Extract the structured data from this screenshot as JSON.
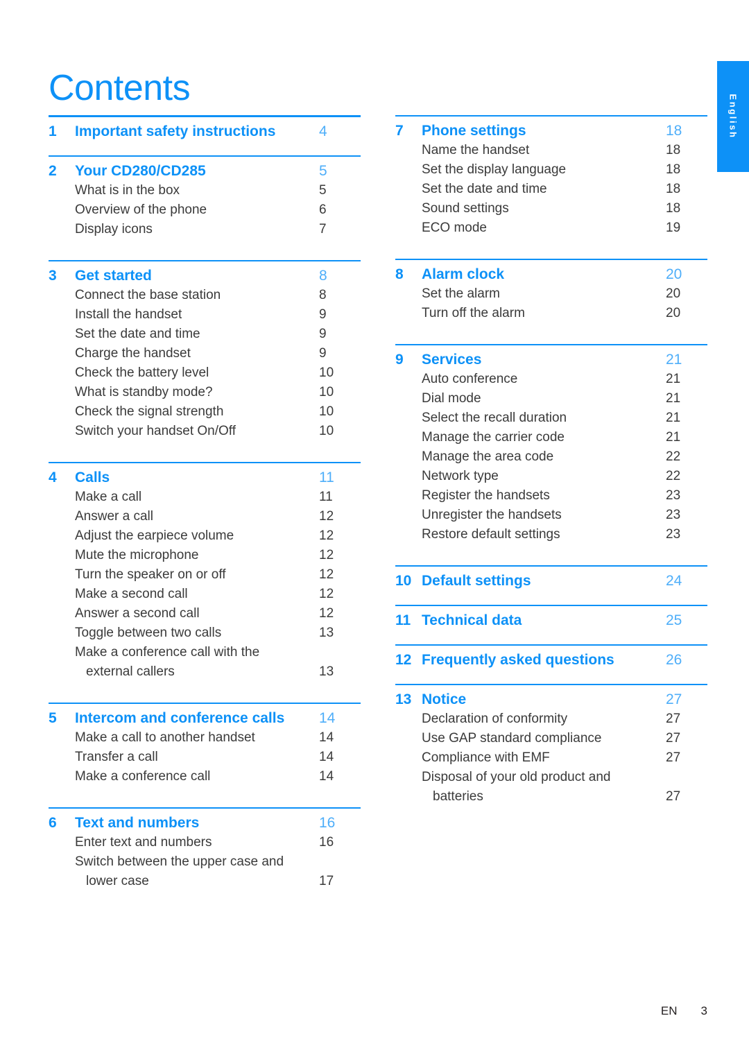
{
  "page_title": "Contents",
  "side_tab": {
    "label": "English"
  },
  "footer": {
    "lang_code": "EN",
    "page_number": "3"
  },
  "colors": {
    "accent": "#0d91f7",
    "accent_light": "#4eaef9",
    "body_text": "#3a3a3a"
  },
  "columns": [
    {
      "sections": [
        {
          "number": "1",
          "title": "Important safety instructions",
          "page": "4",
          "items": []
        },
        {
          "number": "2",
          "title": "Your CD280/CD285",
          "page": "5",
          "items": [
            {
              "label": "What is in the box",
              "page": "5"
            },
            {
              "label": "Overview of the phone",
              "page": "6"
            },
            {
              "label": "Display icons",
              "page": "7"
            }
          ]
        },
        {
          "number": "3",
          "title": "Get started",
          "page": "8",
          "items": [
            {
              "label": "Connect the base station",
              "page": "8"
            },
            {
              "label": "Install the handset",
              "page": "9"
            },
            {
              "label": "Set the date and time",
              "page": "9"
            },
            {
              "label": "Charge the handset",
              "page": "9"
            },
            {
              "label": "Check the battery level",
              "page": "10"
            },
            {
              "label": "What is standby mode?",
              "page": "10"
            },
            {
              "label": "Check the signal strength",
              "page": "10"
            },
            {
              "label": "Switch your handset On/Off",
              "page": "10"
            }
          ]
        },
        {
          "number": "4",
          "title": "Calls",
          "page": "11",
          "items": [
            {
              "label": "Make a call",
              "page": "11"
            },
            {
              "label": "Answer a call",
              "page": "12"
            },
            {
              "label": "Adjust the earpiece volume",
              "page": "12"
            },
            {
              "label": "Mute the microphone",
              "page": "12"
            },
            {
              "label": "Turn the speaker on or off",
              "page": "12"
            },
            {
              "label": "Make a second call",
              "page": "12"
            },
            {
              "label": "Answer a second call",
              "page": "12"
            },
            {
              "label": "Toggle between two calls",
              "page": "13"
            },
            {
              "label": "Make a conference call with the",
              "label_cont": "external callers",
              "page": "13"
            }
          ]
        },
        {
          "number": "5",
          "title": "Intercom and conference calls",
          "page": "14",
          "items": [
            {
              "label": "Make a call to another handset",
              "page": "14"
            },
            {
              "label": "Transfer a call",
              "page": "14"
            },
            {
              "label": "Make a conference call",
              "page": "14"
            }
          ]
        },
        {
          "number": "6",
          "title": "Text and numbers",
          "page": "16",
          "items": [
            {
              "label": "Enter text and numbers",
              "page": "16"
            },
            {
              "label": "Switch between the upper case and",
              "label_cont": "lower case",
              "page": "17"
            }
          ]
        }
      ]
    },
    {
      "sections": [
        {
          "number": "7",
          "title": "Phone settings",
          "page": "18",
          "items": [
            {
              "label": "Name the handset",
              "page": "18"
            },
            {
              "label": "Set the display language",
              "page": "18"
            },
            {
              "label": "Set the date and time",
              "page": "18"
            },
            {
              "label": "Sound settings",
              "page": "18"
            },
            {
              "label": "ECO mode",
              "page": "19"
            }
          ]
        },
        {
          "number": "8",
          "title": "Alarm clock",
          "page": "20",
          "items": [
            {
              "label": "Set the alarm",
              "page": "20"
            },
            {
              "label": "Turn off the alarm",
              "page": "20"
            }
          ]
        },
        {
          "number": "9",
          "title": "Services",
          "page": "21",
          "items": [
            {
              "label": "Auto conference",
              "page": "21"
            },
            {
              "label": "Dial mode",
              "page": "21"
            },
            {
              "label": "Select the recall duration",
              "page": "21"
            },
            {
              "label": "Manage the carrier code",
              "page": "21"
            },
            {
              "label": "Manage the area code",
              "page": "22"
            },
            {
              "label": "Network type",
              "page": "22"
            },
            {
              "label": "Register the handsets",
              "page": "23"
            },
            {
              "label": "Unregister the handsets",
              "page": "23"
            },
            {
              "label": "Restore default settings",
              "page": "23"
            }
          ]
        },
        {
          "number": "10",
          "title": "Default settings",
          "page": "24",
          "items": []
        },
        {
          "number": "11",
          "title": "Technical data",
          "page": "25",
          "items": []
        },
        {
          "number": "12",
          "title": "Frequently asked questions",
          "page": "26",
          "items": []
        },
        {
          "number": "13",
          "title": "Notice",
          "page": "27",
          "items": [
            {
              "label": "Declaration of conformity",
              "page": "27"
            },
            {
              "label": "Use GAP standard compliance",
              "page": "27"
            },
            {
              "label": "Compliance with EMF",
              "page": "27"
            },
            {
              "label": "Disposal of your old product and",
              "label_cont": "batteries",
              "page": "27"
            }
          ]
        }
      ]
    }
  ]
}
